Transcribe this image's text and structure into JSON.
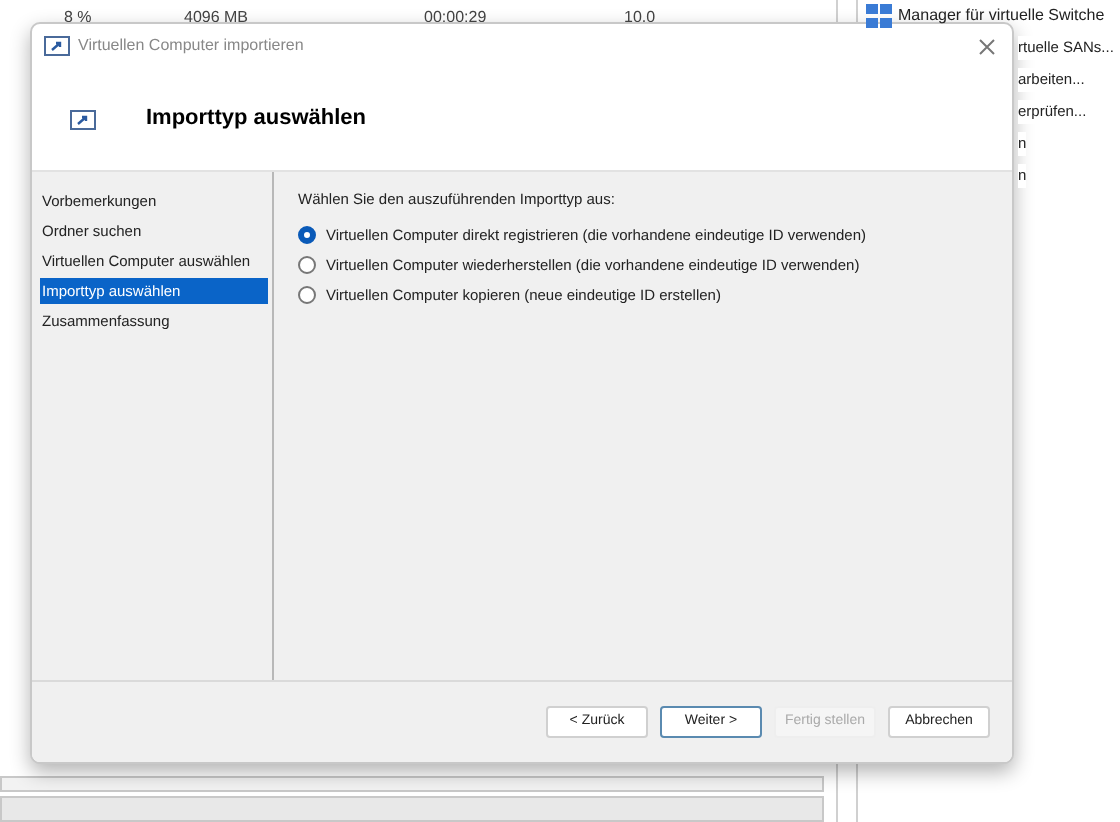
{
  "background": {
    "vm_row": [
      "8 %",
      "4096 MB",
      "00:00:29",
      "10.0"
    ],
    "actions": [
      {
        "label": "Manager für virtuelle Switche",
        "icon": true
      },
      {
        "label": "rtuelle SANs...",
        "icon": false
      },
      {
        "label": "arbeiten...",
        "icon": false
      },
      {
        "label": "erprüfen...",
        "icon": false
      },
      {
        "label": "n",
        "icon": false
      },
      {
        "label": "n",
        "icon": false
      }
    ]
  },
  "dialog": {
    "title": "Virtuellen Computer importieren",
    "heading": "Importtyp auswählen",
    "steps": [
      {
        "label": "Vorbemerkungen",
        "selected": false
      },
      {
        "label": "Ordner suchen",
        "selected": false
      },
      {
        "label": "Virtuellen Computer auswählen",
        "selected": false
      },
      {
        "label": "Importtyp auswählen",
        "selected": true
      },
      {
        "label": "Zusammenfassung",
        "selected": false
      }
    ],
    "prompt": "Wählen Sie den auszuführenden Importtyp aus:",
    "options": [
      {
        "label": "Virtuellen Computer direkt registrieren (die vorhandene eindeutige ID verwenden)",
        "selected": true
      },
      {
        "label": "Virtuellen Computer wiederherstellen (die vorhandene eindeutige ID verwenden)",
        "selected": false
      },
      {
        "label": "Virtuellen Computer kopieren (neue eindeutige ID erstellen)",
        "selected": false
      }
    ],
    "buttons": [
      {
        "label": "< Zurück",
        "disabled": false,
        "default": false
      },
      {
        "label": "Weiter >",
        "disabled": false,
        "default": true
      },
      {
        "label": "Fertig stellen",
        "disabled": true,
        "default": false
      },
      {
        "label": "Abbrechen",
        "disabled": false,
        "default": false
      }
    ]
  }
}
